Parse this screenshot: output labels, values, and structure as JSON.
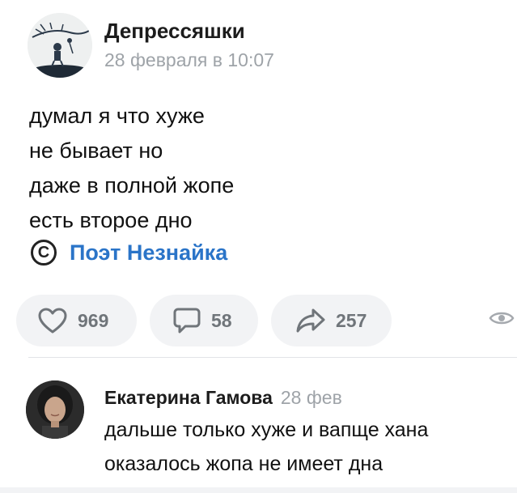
{
  "post": {
    "group_name": "Депрессяшки",
    "date": "28 февраля в 10:07",
    "lines": [
      "думал я что хуже",
      "не бывает но",
      "даже в полной жопе",
      "есть второе дно"
    ],
    "copyright_symbol": "C",
    "author_link": "Поэт Незнайка"
  },
  "actions": {
    "likes": "969",
    "comments": "58",
    "shares": "257"
  },
  "comment": {
    "author": "Екатерина Гамова",
    "date": "28 фев",
    "lines": [
      "дальше только хуже и вапще хана",
      "оказалось жопа не имеет дна"
    ]
  },
  "colors": {
    "link": "#2a74c8",
    "muted": "#9ea3a8",
    "button_bg": "#f2f3f5",
    "icon": "#70757a"
  }
}
